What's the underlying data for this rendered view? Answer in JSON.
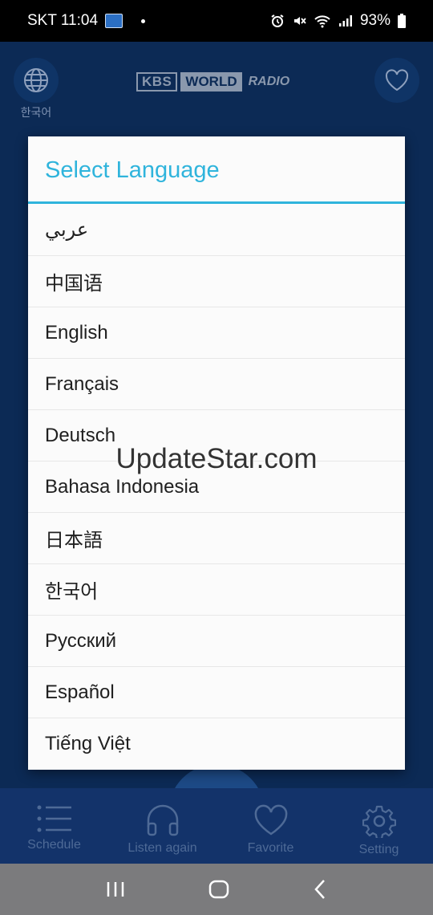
{
  "status_bar": {
    "carrier_time": "SKT 11:04",
    "battery": "93%"
  },
  "app": {
    "language_label": "한국어",
    "logo": {
      "kbs": "KBS",
      "world": "WORLD",
      "radio": "RADIO"
    }
  },
  "dialog": {
    "title": "Select Language",
    "languages": [
      "عربي",
      "中国语",
      "English",
      "Français",
      "Deutsch",
      "Bahasa Indonesia",
      "日本語",
      "한국어",
      "Русский",
      "Español",
      "Tiếng Việt"
    ]
  },
  "bottom_nav": {
    "items": [
      {
        "label": "Schedule",
        "icon": "list-icon"
      },
      {
        "label": "Listen again",
        "icon": "headphones-icon"
      },
      {
        "label": "Favorite",
        "icon": "heart-icon"
      },
      {
        "label": "Setting",
        "icon": "gear-icon"
      }
    ]
  },
  "watermark": "UpdateStar.com",
  "colors": {
    "accent": "#2fb4dc",
    "app_background": "#0c2a55",
    "nav_background": "#13336a"
  }
}
